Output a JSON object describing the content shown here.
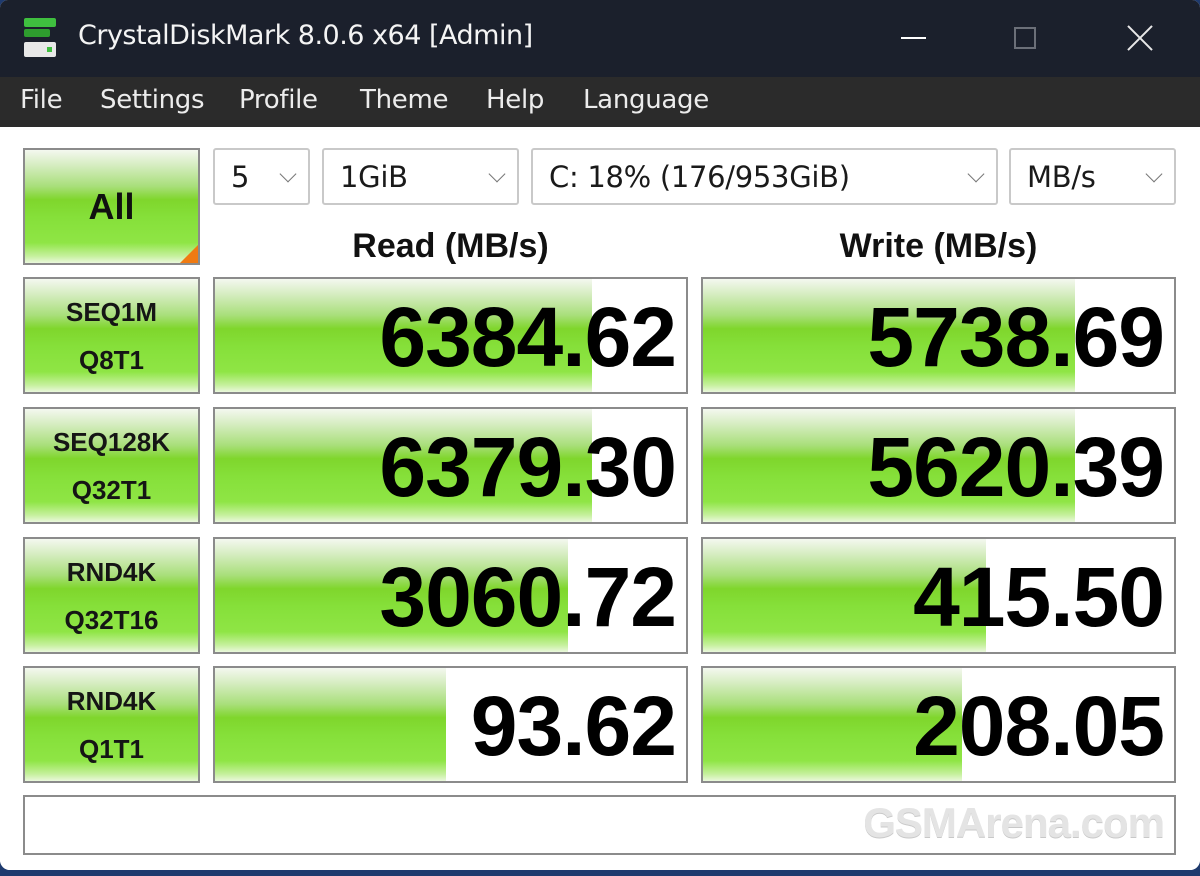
{
  "window": {
    "title": "CrystalDiskMark 8.0.6 x64 [Admin]",
    "icon": "crystaldiskmark-app-icon",
    "controls": [
      "minimize-icon",
      "maximize-icon",
      "close-icon"
    ]
  },
  "menu": {
    "items": [
      "File",
      "Settings",
      "Profile",
      "Theme",
      "Help",
      "Language"
    ]
  },
  "toolbar": {
    "all_button": "All",
    "test_count": "5",
    "test_size": "1GiB",
    "drive": "C: 18% (176/953GiB)",
    "unit": "MB/s"
  },
  "columns": {
    "read": "Read (MB/s)",
    "write": "Write (MB/s)"
  },
  "rows": [
    {
      "label1": "SEQ1M",
      "label2": "Q8T1",
      "read": "6384.62",
      "write": "5738.69",
      "read_fill": 0.8,
      "write_fill": 0.79
    },
    {
      "label1": "SEQ128K",
      "label2": "Q32T1",
      "read": "6379.30",
      "write": "5620.39",
      "read_fill": 0.8,
      "write_fill": 0.79
    },
    {
      "label1": "RND4K",
      "label2": "Q32T16",
      "read": "3060.72",
      "write": "415.50",
      "read_fill": 0.75,
      "write_fill": 0.6
    },
    {
      "label1": "RND4K",
      "label2": "Q1T1",
      "read": "93.62",
      "write": "208.05",
      "read_fill": 0.49,
      "write_fill": 0.55
    }
  ],
  "status": {
    "text": "",
    "watermark": "GSMArena.com"
  },
  "colors": {
    "accent_green": "#7fd62c",
    "corner_orange": "#f07a12",
    "titlebar": "#1b202c",
    "menubar": "#2b2b2b"
  }
}
